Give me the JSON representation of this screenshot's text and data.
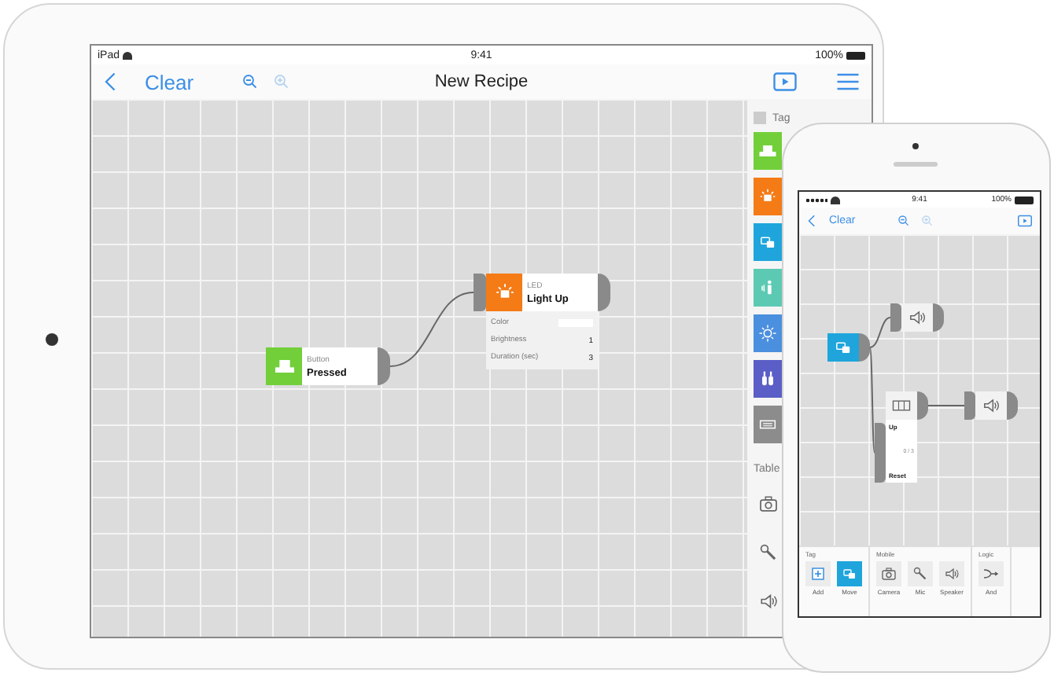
{
  "tablet": {
    "status": {
      "device": "iPad",
      "time": "9:41",
      "battery": "100%"
    },
    "nav": {
      "back_label": "Clear",
      "title": "New Recipe",
      "tools": [
        {
          "kind": "zoom-out",
          "disabled": false
        },
        {
          "kind": "zoom-in",
          "disabled": true
        }
      ],
      "actions": [
        {
          "kind": "stage"
        },
        {
          "kind": "menu"
        }
      ]
    },
    "nodes": [
      {
        "kind": "button",
        "color": "#72cf3a",
        "type": "Button",
        "state": "Pressed",
        "input": false
      },
      {
        "kind": "led",
        "color": "#f47b16",
        "type": "LED",
        "state": "Light Up",
        "input": true,
        "properties": [
          {
            "label": "Color",
            "kind": "swatch"
          },
          {
            "label": "Brightness",
            "kind": "value",
            "value": "1"
          },
          {
            "label": "Duration (sec)",
            "kind": "value",
            "value": "3"
          }
        ]
      }
    ],
    "palette": {
      "tag_title": "Tag",
      "tag_items": [
        {
          "kind": "button",
          "color": "#72cf3a"
        },
        {
          "kind": "led",
          "color": "#f47b16"
        },
        {
          "kind": "motion",
          "color": "#1fa5dc"
        },
        {
          "kind": "figure",
          "color": "#5ccab3"
        },
        {
          "kind": "sun",
          "color": "#4b8fdf"
        },
        {
          "kind": "bottles",
          "color": "#5a5ec6"
        },
        {
          "kind": "keyboard",
          "color": "#8c8c8c"
        }
      ],
      "tablet_title": "Table",
      "tablet_items": [
        {
          "kind": "camera"
        },
        {
          "kind": "mic"
        },
        {
          "kind": "speaker"
        }
      ]
    }
  },
  "phone": {
    "status": {
      "time": "9:41",
      "battery": "100%"
    },
    "nav": {
      "back_label": "Clear",
      "tools": [
        {
          "kind": "zoom-out",
          "disabled": false
        },
        {
          "kind": "zoom-in",
          "disabled": true
        }
      ],
      "actions": [
        {
          "kind": "stage"
        }
      ]
    },
    "nodes": [
      {
        "kind": "motion",
        "color": "#1fa5dc",
        "input": false
      },
      {
        "kind": "speaker",
        "color": "#f2f2f2",
        "input": true
      },
      {
        "kind": "counter",
        "color": "#f2f2f2",
        "input": true,
        "up_label": "Up",
        "count": "0 / 3",
        "reset_label": "Reset"
      },
      {
        "kind": "speaker",
        "color": "#f2f2f2",
        "input": true
      }
    ],
    "toolbar": [
      {
        "title": "Tag",
        "items": [
          {
            "kind": "add",
            "label": "Add",
            "selected": false
          },
          {
            "kind": "motion",
            "label": "Move",
            "selected": true
          }
        ]
      },
      {
        "title": "Mobile",
        "items": [
          {
            "kind": "camera",
            "label": "Camera",
            "selected": false
          },
          {
            "kind": "mic",
            "label": "Mic",
            "selected": false
          },
          {
            "kind": "speaker",
            "label": "Speaker",
            "selected": false
          }
        ]
      },
      {
        "title": "Logic",
        "items": [
          {
            "kind": "and",
            "label": "And",
            "selected": false
          }
        ]
      }
    ]
  }
}
